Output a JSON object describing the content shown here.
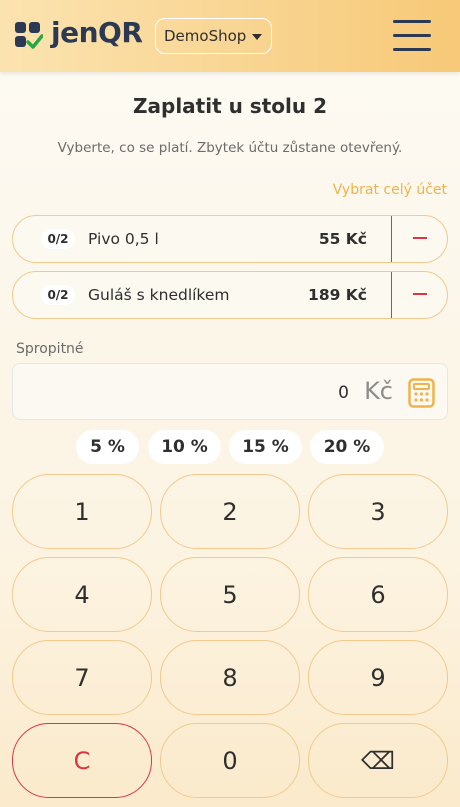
{
  "header": {
    "brand": "jenQR",
    "shop_selector": "DemoShop"
  },
  "page": {
    "title": "Zaplatit u stolu 2",
    "subtitle": "Vyberte, co se platí. Zbytek účtu zůstane otevřený.",
    "select_all": "Vybrat celý účet"
  },
  "items": [
    {
      "qty": "0/2",
      "name": "Pivo 0,5 l",
      "price": "55 Kč"
    },
    {
      "qty": "0/2",
      "name": "Guláš s knedlíkem",
      "price": "189 Kč"
    }
  ],
  "tip": {
    "label": "Spropitné",
    "value": "0",
    "unit": "Kč"
  },
  "tip_presets": [
    "5 %",
    "10 %",
    "15 %",
    "20 %"
  ],
  "keypad": [
    "1",
    "2",
    "3",
    "4",
    "5",
    "6",
    "7",
    "8",
    "9",
    "C",
    "0",
    "⌫"
  ],
  "colors": {
    "accent": "#f7c978",
    "danger": "#dc3545",
    "link": "#f0b24a",
    "logo_green": "#28a745",
    "navy": "#2b3a52"
  },
  "icons": {
    "logo": "grid-check-icon",
    "menu": "hamburger-icon",
    "calculator": "calculator-icon",
    "remove": "minus-icon",
    "backspace": "backspace-icon"
  }
}
